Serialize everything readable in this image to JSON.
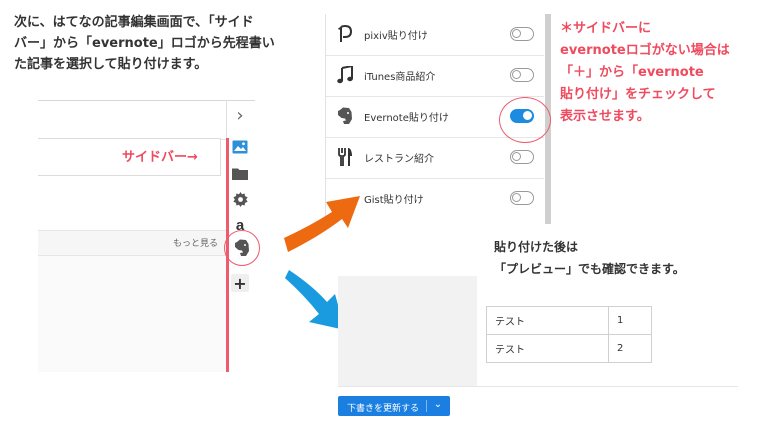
{
  "instructions": {
    "line1": "次に、はてなの記事編集画面で、「サイド",
    "line2": "バー」から「evernote」ロゴから先程書い",
    "line3": "た記事を選択して貼り付けます。"
  },
  "note_red": {
    "line1": "＊サイドバーに",
    "line2": "evernoteロゴがない場合は",
    "line3": "「＋」から「evernote",
    "line4": "貼り付け」をチェックして",
    "line5": "表示させます。"
  },
  "note_preview": {
    "line1": "貼り付けた後は",
    "line2": "「プレビュー」でも確認できます。"
  },
  "left_editor": {
    "sidebar_label": "サイドバー→",
    "more_link": "もっと見る",
    "collapse_glyph": "›",
    "add_glyph": "+"
  },
  "plugins": [
    {
      "label": "pixiv貼り付け",
      "icon": "pixiv-icon",
      "glyph": "P",
      "enabled": false
    },
    {
      "label": "iTunes商品紹介",
      "icon": "music-note-icon",
      "glyph": "♫",
      "enabled": false
    },
    {
      "label": "Evernote貼り付け",
      "icon": "evernote-icon",
      "glyph": "🐘",
      "enabled": true
    },
    {
      "label": "レストラン紹介",
      "icon": "restaurant-icon",
      "glyph": "🍴",
      "enabled": false
    },
    {
      "label": "Gist貼り付け",
      "icon": "gist-icon",
      "glyph": "",
      "enabled": false
    }
  ],
  "preview_table": [
    [
      "テスト",
      "1"
    ],
    [
      "テスト",
      "2"
    ]
  ],
  "update_button": {
    "label": "下書きを更新する",
    "dropdown_glyph": "⌄"
  },
  "colors": {
    "accent_red": "#ef4a5e",
    "toggle_on": "#1d8be0",
    "button_blue": "#1a7fe0",
    "arrow_orange": "#ee6a10",
    "arrow_blue": "#1a9be0"
  }
}
